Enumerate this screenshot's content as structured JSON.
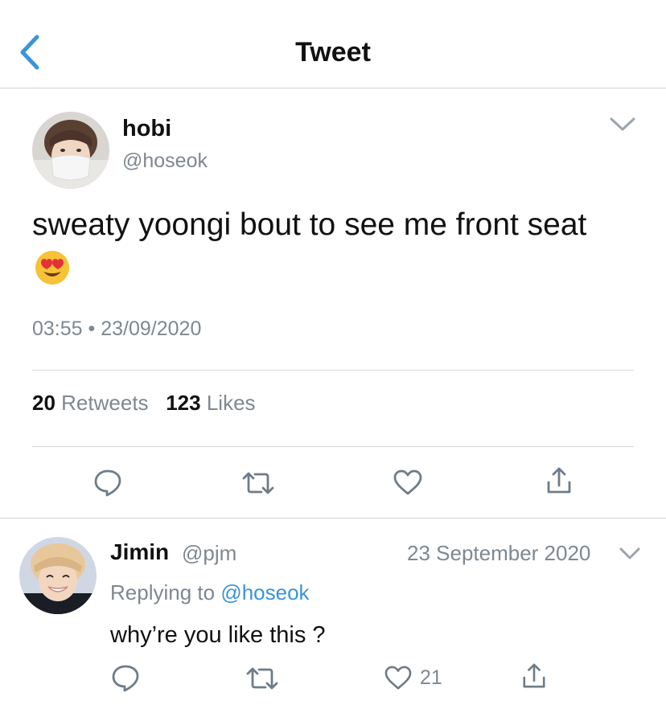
{
  "header": {
    "title": "Tweet"
  },
  "tweet": {
    "author_name": "hobi",
    "author_handle": "@hoseok",
    "text": "sweaty yoongi bout to see me front seat",
    "emoji": "😍",
    "time": "03:55",
    "date": "23/09/2020",
    "time_separator": "•",
    "retweet_count": "20",
    "retweet_label": "Retweets",
    "like_count": "123",
    "like_label": "Likes"
  },
  "reply": {
    "author_name": "Jimin",
    "author_handle": "@pjm",
    "date": "23 September 2020",
    "replying_prefix": "Replying to",
    "replying_to": "@hoseok",
    "text": "why’re you like this ?",
    "like_count": "21"
  },
  "colors": {
    "accent": "#3b94d9",
    "icon_gray": "#6e7c87",
    "divider": "#d5d9dc"
  }
}
